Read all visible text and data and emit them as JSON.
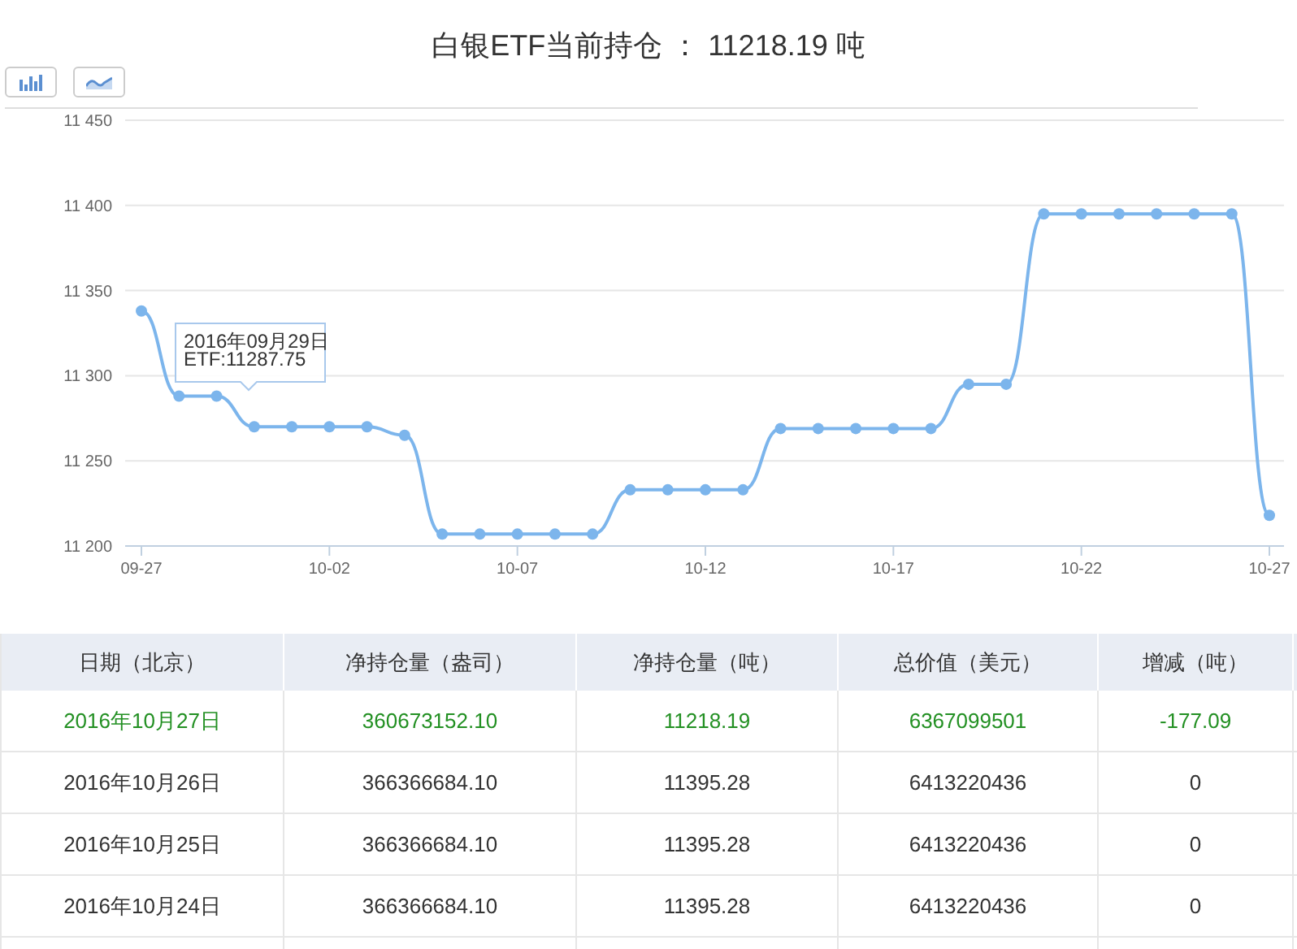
{
  "title": "白银ETF当前持仓 ： 11218.19 吨",
  "chart_buttons": [
    {
      "kind": "bar"
    },
    {
      "kind": "line"
    }
  ],
  "chart_data": {
    "type": "line",
    "categories": [
      "09-27",
      null,
      null,
      null,
      null,
      "10-02",
      null,
      null,
      null,
      null,
      "10-07",
      null,
      null,
      null,
      null,
      "10-12",
      null,
      null,
      null,
      null,
      "10-17",
      null,
      null,
      null,
      null,
      "10-22",
      null,
      null,
      null,
      null,
      "10-27"
    ],
    "series": [
      {
        "color": "#7cb5ec",
        "marker": true,
        "values": [
          11338,
          11288,
          11288,
          11270,
          11270,
          11270,
          11270,
          11265,
          11207,
          11207,
          11207,
          11207,
          11207,
          11233,
          11233,
          11233,
          11233,
          11269,
          11269,
          11269,
          11269,
          11269,
          11295,
          11295,
          11395,
          11395,
          11395,
          11395,
          11395,
          11395,
          11218
        ]
      }
    ],
    "grid": true,
    "ylim": [
      11200,
      11450
    ],
    "yticks": [
      {
        "value": 11200,
        "label": "11 200"
      },
      {
        "value": 11250,
        "label": "11 250"
      },
      {
        "value": 11300,
        "label": "11 300"
      },
      {
        "value": 11350,
        "label": "11 350"
      },
      {
        "value": 11400,
        "label": "11 400"
      },
      {
        "value": 11450,
        "label": "11 450"
      }
    ]
  },
  "tooltip": {
    "lines": [
      "2016年09月29日",
      "ETF:11287.75"
    ]
  },
  "table": {
    "columns": [
      "日期（北京）",
      "净持仓量（盎司）",
      "净持仓量（吨）",
      "总价值（美元）",
      "增减（吨）"
    ],
    "rows": [
      {
        "highlight": true,
        "cells": [
          "2016年10月27日",
          "360673152.10",
          "11218.19",
          "6367099501",
          "-177.09"
        ]
      },
      {
        "highlight": false,
        "cells": [
          "2016年10月26日",
          "366366684.10",
          "11395.28",
          "6413220436",
          "0"
        ]
      },
      {
        "highlight": false,
        "cells": [
          "2016年10月25日",
          "366366684.10",
          "11395.28",
          "6413220436",
          "0"
        ]
      },
      {
        "highlight": false,
        "cells": [
          "2016年10月24日",
          "366366684.10",
          "11395.28",
          "6413220436",
          "0"
        ]
      }
    ]
  }
}
